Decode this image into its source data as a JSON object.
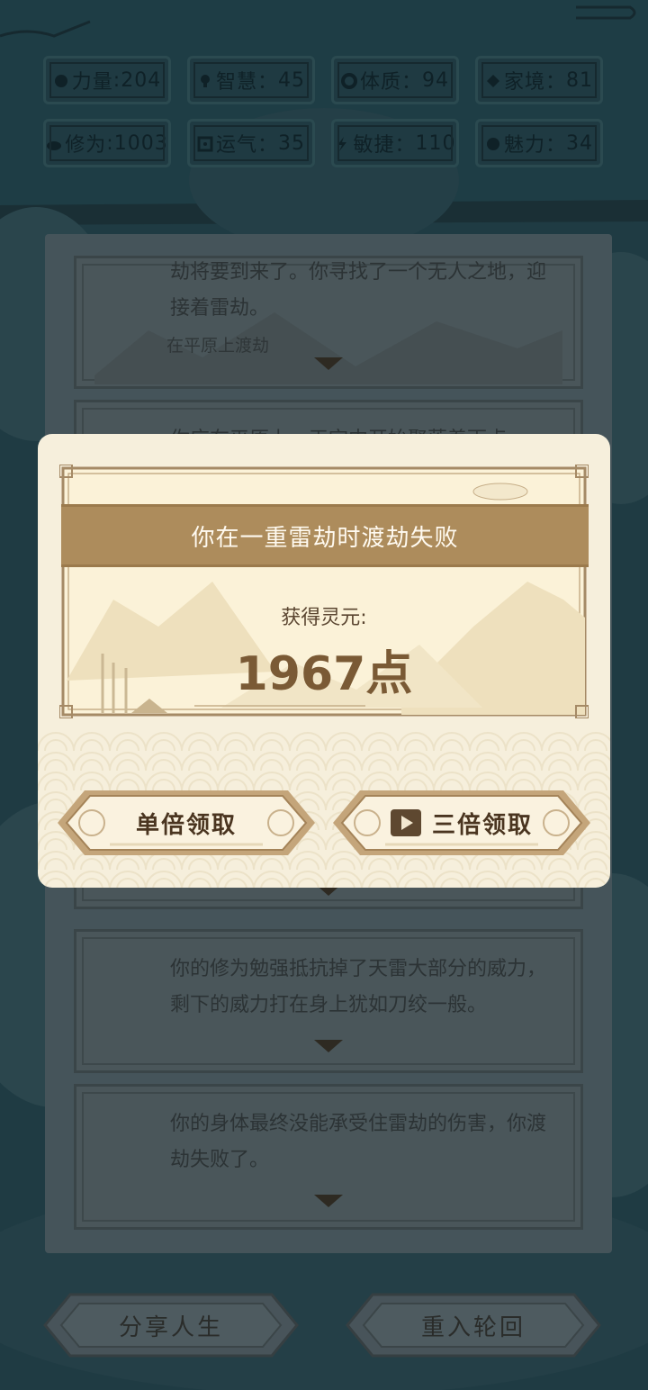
{
  "stats": [
    {
      "label": "力量",
      "value": "204",
      "icon": "strength-icon"
    },
    {
      "label": "智慧",
      "value": "45",
      "icon": "wisdom-icon"
    },
    {
      "label": "体质",
      "value": "94",
      "icon": "constitution-icon"
    },
    {
      "label": "家境",
      "value": "81",
      "icon": "family-icon"
    },
    {
      "label": "修为",
      "value": "1003",
      "icon": "cultivation-icon"
    },
    {
      "label": "运气",
      "value": "35",
      "icon": "luck-icon"
    },
    {
      "label": "敏捷",
      "value": "110",
      "icon": "agility-icon"
    },
    {
      "label": "魅力",
      "value": "34",
      "icon": "charm-icon"
    }
  ],
  "events": {
    "card1": {
      "text": "劫将要到来了。你寻找了一个无人之地，迎接着雷劫。",
      "note": "在平原上渡劫"
    },
    "card2": {
      "text": "你应在平原上，天空中开始聚落着雨点"
    },
    "card4": {
      "text": "你的修为勉强抵抗掉了天雷大部分的威力，剩下的威力打在身上犹如刀绞一般。"
    },
    "card5": {
      "text": "你的身体最终没能承受住雷劫的伤害，你渡劫失败了。"
    }
  },
  "modal": {
    "title": "你在一重雷劫时渡劫失败",
    "reward_label": "获得灵元:",
    "reward_value": "1967点",
    "single_button": "单倍领取",
    "triple_button": "三倍领取"
  },
  "bottom": {
    "share": "分享人生",
    "restart": "重入轮回"
  },
  "colors": {
    "banner": "#ad8c5c",
    "modal_bg": "#f6efdc",
    "reward_value": "#7a5a35",
    "page_bg": "#1e3a42"
  }
}
